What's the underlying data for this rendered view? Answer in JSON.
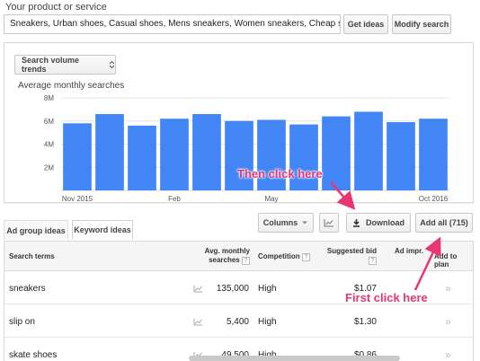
{
  "product": {
    "label": "Your product or service",
    "value": "Sneakers, Urban shoes, Casual shoes, Mens sneakers, Women sneakers, Cheap sneakers, Lu",
    "get_ideas": "Get ideas",
    "modify_search": "Modify search"
  },
  "chart_panel": {
    "select_label": "Search volume trends",
    "title": "Average monthly searches"
  },
  "chart_data": {
    "type": "bar",
    "title": "Average monthly searches",
    "x_tick_labels": [
      "Nov 2015",
      "Feb",
      "May",
      "Oct 2016"
    ],
    "y_tick_labels": [
      "2M",
      "4M",
      "6M",
      "8M"
    ],
    "ylim": [
      0,
      8000000
    ],
    "values": [
      5800000,
      6600000,
      5600000,
      6200000,
      6600000,
      6000000,
      6100000,
      5700000,
      6400000,
      6800000,
      5900000,
      6200000
    ],
    "color": "#4285f4",
    "grid": true
  },
  "tabs": {
    "ad_group": "Ad group ideas",
    "keyword": "Keyword ideas"
  },
  "toolbar": {
    "columns": "Columns",
    "download": "Download",
    "add_all": "Add all (715)"
  },
  "table": {
    "headers": {
      "search_terms": "Search terms",
      "avg_monthly": "Avg. monthly",
      "avg_monthly_2": "searches",
      "competition": "Competition",
      "suggested_bid": "Suggested bid",
      "ad_impr": "Ad impr.",
      "add_to_plan": "Add to plan"
    },
    "rows": [
      {
        "term": "sneakers",
        "searches": "135,000",
        "competition": "High",
        "bid": "$1.07"
      },
      {
        "term": "slip on",
        "searches": "5,400",
        "competition": "High",
        "bid": "$1.30"
      },
      {
        "term": "skate shoes",
        "searches": "49,500",
        "competition": "High",
        "bid": "$0.86"
      }
    ]
  },
  "annotations": {
    "then": "Then click here",
    "first": "First click here",
    "color": "#e83573"
  }
}
